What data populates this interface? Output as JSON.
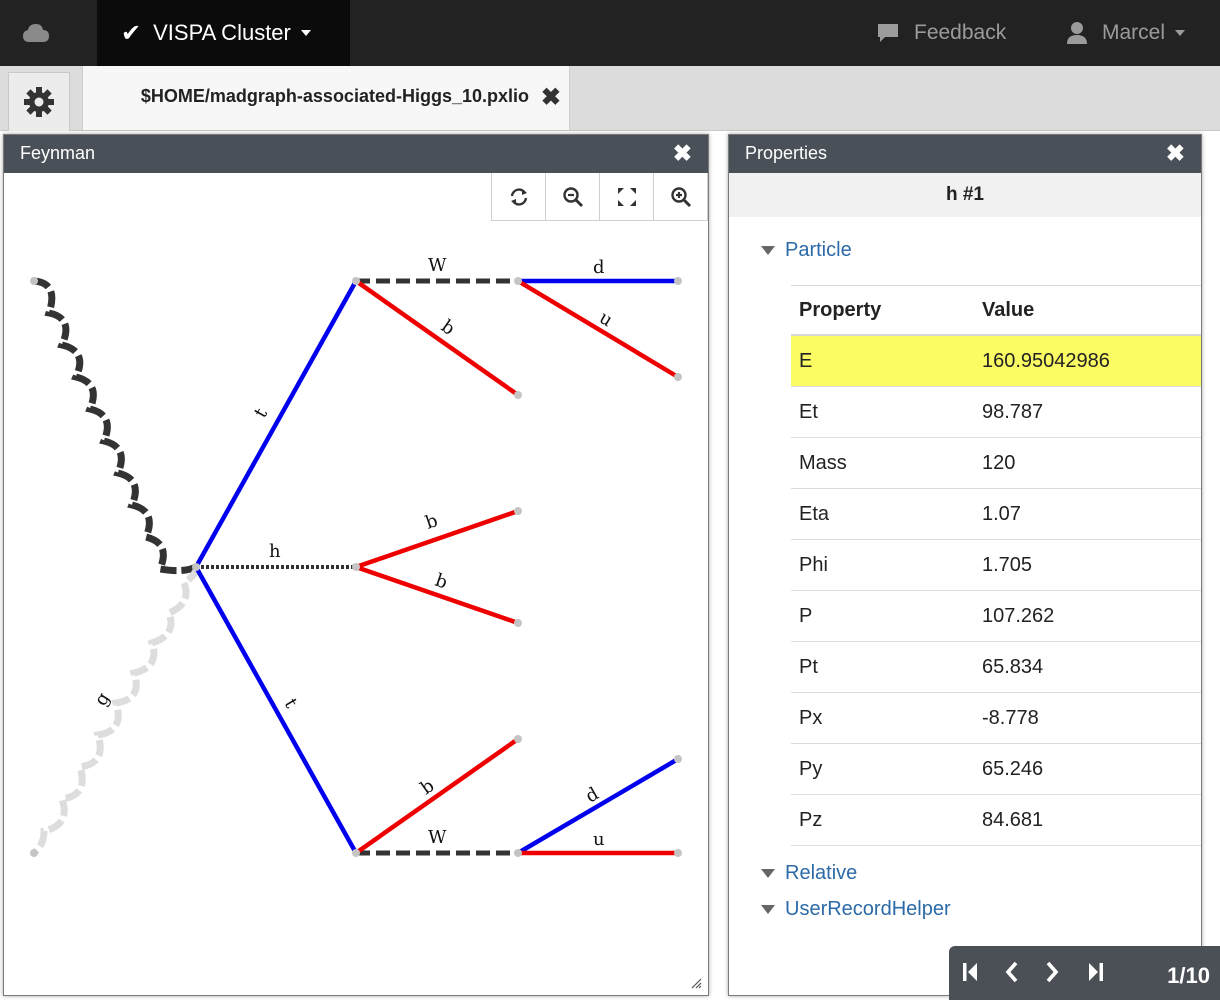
{
  "navbar": {
    "brand": "VISPA Cluster",
    "feedback": "Feedback",
    "user": "Marcel"
  },
  "tabs": {
    "file_tab": "$HOME/madgraph-associated-Higgs_10.pxlio"
  },
  "feynman": {
    "title": "Feynman",
    "toolbar": [
      "refresh-icon",
      "zoom-out-icon",
      "fit-icon",
      "zoom-in-icon"
    ],
    "labels": {
      "gluon_lower": "g",
      "top_upper": "t",
      "top_lower": "t",
      "higgs": "h",
      "w_upper": "W",
      "w_lower": "W",
      "b_upper": "b",
      "b_higgs_1": "b",
      "b_higgs_2": "b",
      "b_lower": "b",
      "d_upper": "d",
      "u_upper": "u",
      "d_lower": "d",
      "u_lower": "u"
    },
    "colors": {
      "quark_top": "#0000ee",
      "quark_b": "#ee0000",
      "gluon": "#333333",
      "gluon_faded": "#dddddd",
      "boson": "#333333"
    }
  },
  "properties": {
    "title": "Properties",
    "object": "h #1",
    "sections": [
      "Particle",
      "Relative",
      "UserRecordHelper"
    ],
    "headers": [
      "Property",
      "Value"
    ],
    "rows": [
      {
        "property": "E",
        "value": "160.95042986",
        "highlight": true
      },
      {
        "property": "Et",
        "value": "98.787"
      },
      {
        "property": "Mass",
        "value": "120"
      },
      {
        "property": "Eta",
        "value": "1.07"
      },
      {
        "property": "Phi",
        "value": "1.705"
      },
      {
        "property": "P",
        "value": "107.262"
      },
      {
        "property": "Pt",
        "value": "65.834"
      },
      {
        "property": "Px",
        "value": "-8.778"
      },
      {
        "property": "Py",
        "value": "65.246"
      },
      {
        "property": "Pz",
        "value": "84.681"
      }
    ],
    "highlight_color": "#fbfb64"
  },
  "pager": {
    "count": "1/10"
  }
}
